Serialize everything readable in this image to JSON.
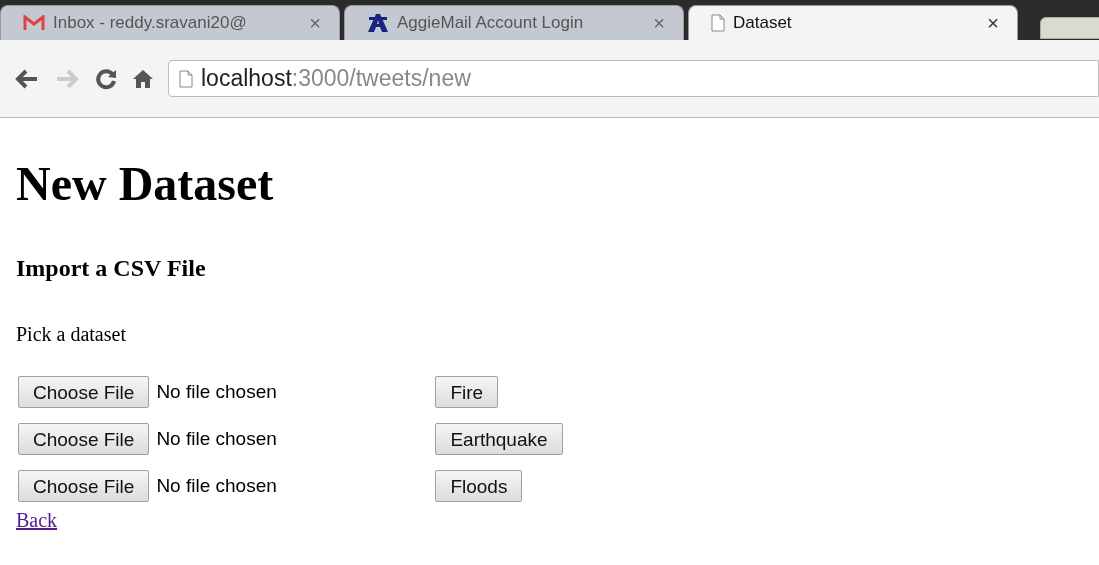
{
  "browser": {
    "tabs": [
      {
        "kind": "mail",
        "title": "Inbox - reddy.sravani20@",
        "selected": false
      },
      {
        "kind": "school",
        "title": "AggieMail Account Login",
        "selected": false
      },
      {
        "kind": "document",
        "title": "Dataset",
        "selected": true
      }
    ],
    "close_glyph": "×",
    "address": {
      "host": "localhost",
      "rest": ":3000/tweets/new"
    }
  },
  "page": {
    "heading": "New Dataset",
    "subheading": "Import a CSV File",
    "prompt": "Pick a dataset",
    "rows": [
      {
        "file_button": "Choose File",
        "file_status": "No file chosen",
        "action": "Fire"
      },
      {
        "file_button": "Choose File",
        "file_status": "No file chosen",
        "action": "Earthquake"
      },
      {
        "file_button": "Choose File",
        "file_status": "No file chosen",
        "action": "Floods"
      }
    ],
    "back_link": "Back"
  }
}
